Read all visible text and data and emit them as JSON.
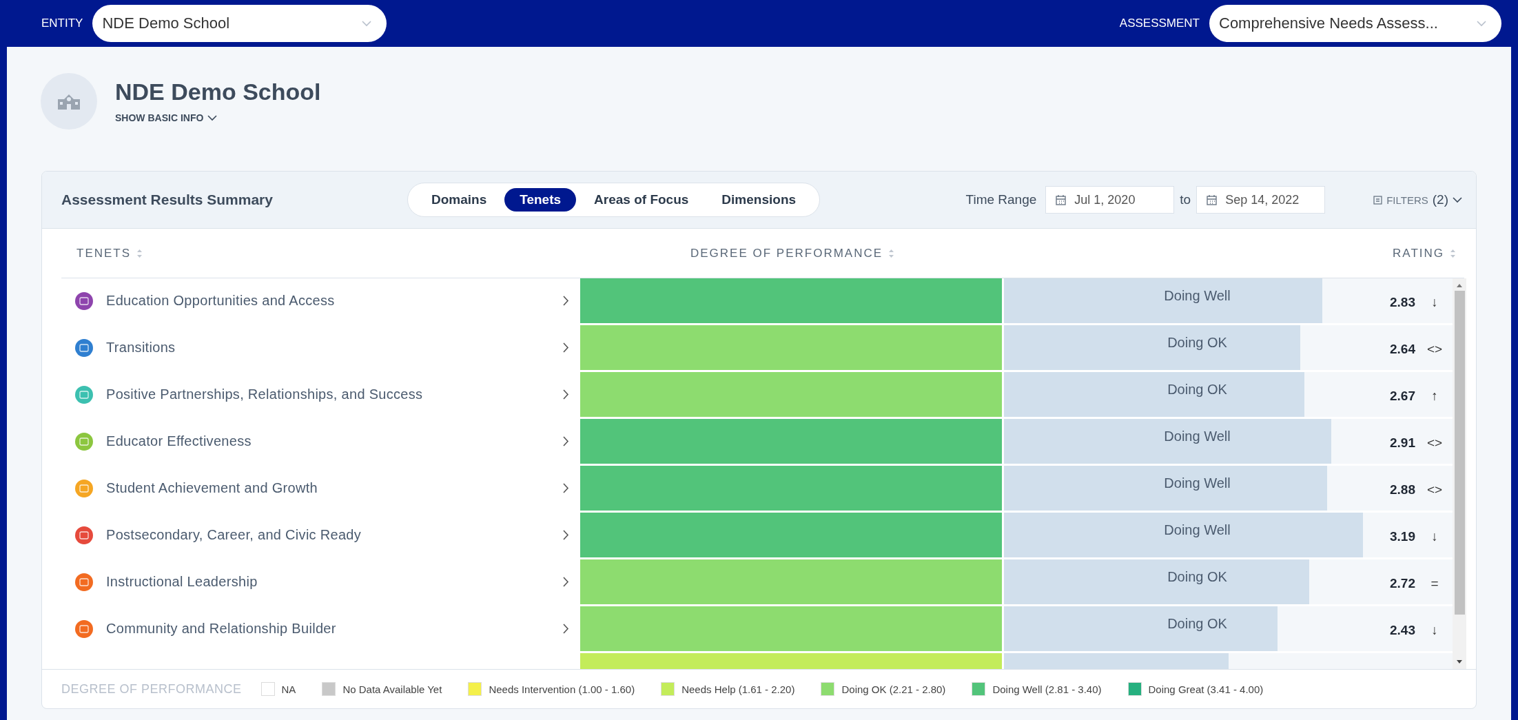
{
  "top_bar": {
    "entity_label": "ENTITY",
    "entity_value": "NDE Demo School",
    "assessment_label": "ASSESSMENT",
    "assessment_value": "Comprehensive Needs Assess..."
  },
  "header": {
    "title": "NDE Demo School",
    "toggle": "SHOW BASIC INFO"
  },
  "summary": {
    "title": "Assessment Results Summary",
    "tabs": [
      {
        "label": "Domains",
        "selected": false
      },
      {
        "label": "Tenets",
        "selected": true
      },
      {
        "label": "Areas of Focus",
        "selected": false
      },
      {
        "label": "Dimensions",
        "selected": false
      }
    ],
    "time_range_label": "Time Range",
    "from_date": "Jul 1, 2020",
    "to_label": "to",
    "to_date": "Sep 14, 2022",
    "filters_label": "FILTERS",
    "filters_count": "(2)",
    "columns": [
      "TENETS",
      "DEGREE OF PERFORMANCE",
      "RATING"
    ],
    "rows": [
      {
        "name": "Education Opportunities and Access",
        "icon": {
          "color": "#8e44ad"
        },
        "band": {
          "color": "#52c47a"
        },
        "status": "Doing Well",
        "level": 0.71,
        "rating": "2.83",
        "trend": "↓"
      },
      {
        "name": "Transitions",
        "icon": {
          "color": "#2f7fd0"
        },
        "band": {
          "color": "#8ddc6f"
        },
        "status": "Doing OK",
        "level": 0.66,
        "rating": "2.64",
        "trend": "<>"
      },
      {
        "name": "Positive Partnerships, Relationships, and Success",
        "icon": {
          "color": "#3cc0b0"
        },
        "band": {
          "color": "#8ddc6f"
        },
        "status": "Doing OK",
        "level": 0.67,
        "rating": "2.67",
        "trend": "↑"
      },
      {
        "name": "Educator Effectiveness",
        "icon": {
          "color": "#8cc63f"
        },
        "band": {
          "color": "#52c47a"
        },
        "status": "Doing Well",
        "level": 0.73,
        "rating": "2.91",
        "trend": "<>"
      },
      {
        "name": "Student Achievement and Growth",
        "icon": {
          "color": "#f5a623"
        },
        "band": {
          "color": "#52c47a"
        },
        "status": "Doing Well",
        "level": 0.72,
        "rating": "2.88",
        "trend": "<>"
      },
      {
        "name": "Postsecondary, Career, and Civic Ready",
        "icon": {
          "color": "#e64a3c"
        },
        "band": {
          "color": "#52c47a"
        },
        "status": "Doing Well",
        "level": 0.8,
        "rating": "3.19",
        "trend": "↓"
      },
      {
        "name": "Instructional Leadership",
        "icon": {
          "color": "#f26b21"
        },
        "band": {
          "color": "#8ddc6f"
        },
        "status": "Doing OK",
        "level": 0.68,
        "rating": "2.72",
        "trend": "="
      },
      {
        "name": "Community and Relationship Builder",
        "icon": {
          "color": "#f26b21"
        },
        "band": {
          "color": "#8ddc6f"
        },
        "status": "Doing OK",
        "level": 0.61,
        "rating": "2.43",
        "trend": "↓"
      }
    ],
    "partial_row": {
      "band": {
        "color": "#c3ec5a"
      },
      "level": 0.5
    },
    "legend_title": "DEGREE OF PERFORMANCE",
    "legend": [
      {
        "label": "NA",
        "color": "#ffffff"
      },
      {
        "label": "No Data Available Yet",
        "color": "#c8c8c8"
      },
      {
        "label": "Needs Intervention (1.00 - 1.60)",
        "color": "#f4f04a"
      },
      {
        "label": "Needs Help (1.61 - 2.20)",
        "color": "#c3ec5a"
      },
      {
        "label": "Doing OK (2.21 - 2.80)",
        "color": "#8ddc6f"
      },
      {
        "label": "Doing Well (2.81 - 3.40)",
        "color": "#52c47a"
      },
      {
        "label": "Doing Great (3.41 - 4.00)",
        "color": "#26b07f"
      }
    ]
  }
}
